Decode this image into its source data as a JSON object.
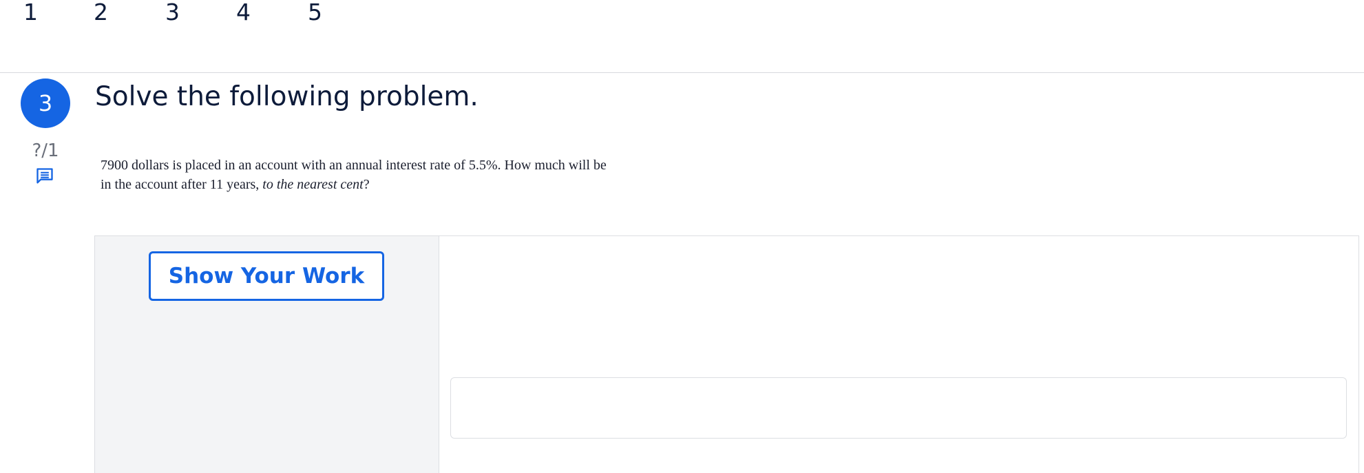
{
  "nav": {
    "items": [
      "1",
      "2",
      "3",
      "4",
      "5"
    ]
  },
  "question": {
    "number": "3",
    "score": "?/1",
    "title": "Solve the following problem.",
    "text_part1": "7900 dollars is placed in an account with an annual interest rate of 5.5%. How much will be in the account after 11 years, ",
    "text_emphasis": "to the nearest cent",
    "text_part2": "?"
  },
  "work": {
    "show_work_label": "Show Your Work"
  },
  "answer": {
    "value": "",
    "placeholder": ""
  },
  "colors": {
    "accent": "#1565e3",
    "text": "#0d1b3a",
    "panel_bg": "#f3f4f6",
    "border": "#dcdee2"
  },
  "icons": {
    "comment": "comment-icon"
  }
}
